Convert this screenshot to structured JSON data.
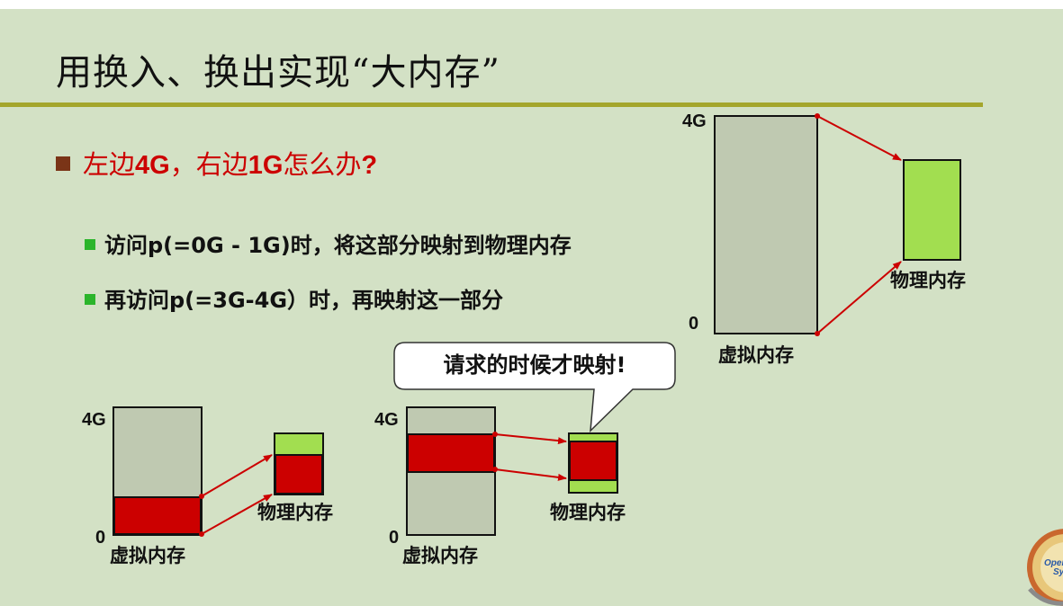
{
  "slide": {
    "title": "用换入、换出实现“大内存”",
    "bullet_main_prefix": "左边",
    "bullet_main_left": "4G",
    "bullet_main_mid": "，右边",
    "bullet_main_right": "1G",
    "bullet_main_suffix": "怎么办",
    "bullet_main_q": "?",
    "sub_bullets": [
      "访问p(=0G - 1G)时，将这部分映射到物理内存",
      "再访问p(=3G-4G）时，再映射这一部分"
    ]
  },
  "diagram": {
    "callout": "请求的时候才映射!",
    "figures": [
      {
        "top_label": "4G",
        "bottom_label": "0",
        "virtual_label": "虚拟内存",
        "physical_label": "物理内存"
      },
      {
        "top_label": "4G",
        "bottom_label": "0",
        "virtual_label": "虚拟内存",
        "physical_label": "物理内存"
      },
      {
        "top_label": "4G",
        "bottom_label": "0",
        "virtual_label": "虚拟内存",
        "physical_label": "物理内存"
      }
    ]
  },
  "colors": {
    "background": "#d3e1c5",
    "virtual_memory": "#bfc9b1",
    "physical_memory": "#a2de50",
    "mapped_region": "#cc0000",
    "title_rule": "#a4a62c",
    "main_bullet_text": "#cc0000"
  },
  "logo": {
    "text": "Oper Sy"
  }
}
